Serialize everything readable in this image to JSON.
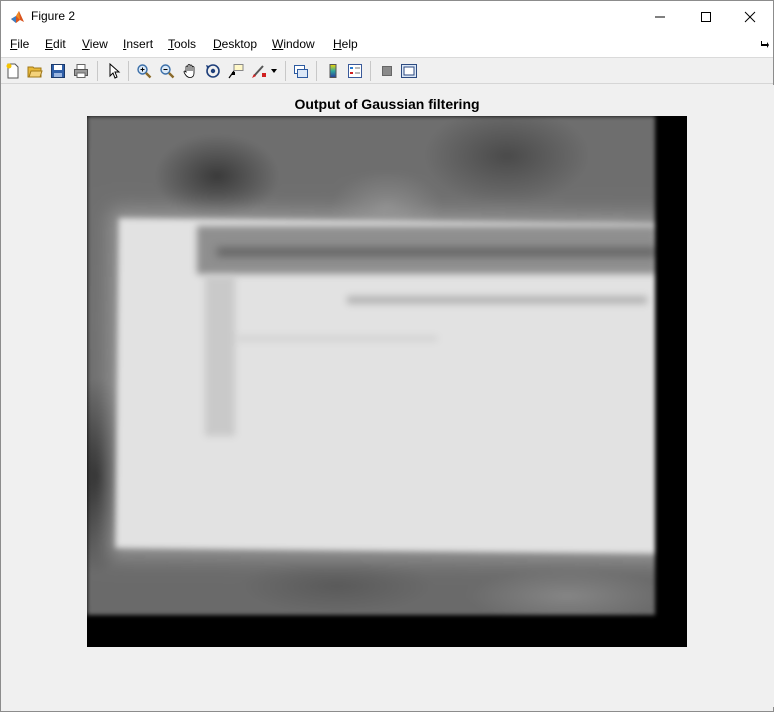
{
  "window": {
    "title": "Figure 2",
    "app_icon": "matlab-icon",
    "controls": [
      "minimize-icon",
      "maximize-icon",
      "close-icon"
    ]
  },
  "menubar": {
    "items": [
      {
        "label": "File",
        "mnemonic": "F",
        "rest": "ile"
      },
      {
        "label": "Edit",
        "mnemonic": "E",
        "rest": "dit"
      },
      {
        "label": "View",
        "mnemonic": "V",
        "rest": "iew"
      },
      {
        "label": "Insert",
        "mnemonic": "I",
        "rest": "nsert"
      },
      {
        "label": "Tools",
        "mnemonic": "T",
        "rest": "ools"
      },
      {
        "label": "Desktop",
        "mnemonic": "D",
        "rest": "esktop"
      },
      {
        "label": "Window",
        "mnemonic": "W",
        "rest": "indow"
      },
      {
        "label": "Help",
        "mnemonic": "H",
        "rest": "elp"
      }
    ]
  },
  "toolbar": {
    "buttons": [
      "new-figure-icon",
      "open-file-icon",
      "save-figure-icon",
      "print-figure-icon",
      "edit-plot-icon",
      "zoom-in-icon",
      "zoom-out-icon",
      "pan-icon",
      "rotate-3d-icon",
      "data-cursor-icon",
      "brush-icon",
      "link-plot-icon",
      "colorbar-icon",
      "legend-icon",
      "hide-plot-tools-icon",
      "show-plot-tools-icon"
    ]
  },
  "figure": {
    "title": "Output of Gaussian filtering",
    "image_description_type": "grayscale-blurred-photo"
  }
}
